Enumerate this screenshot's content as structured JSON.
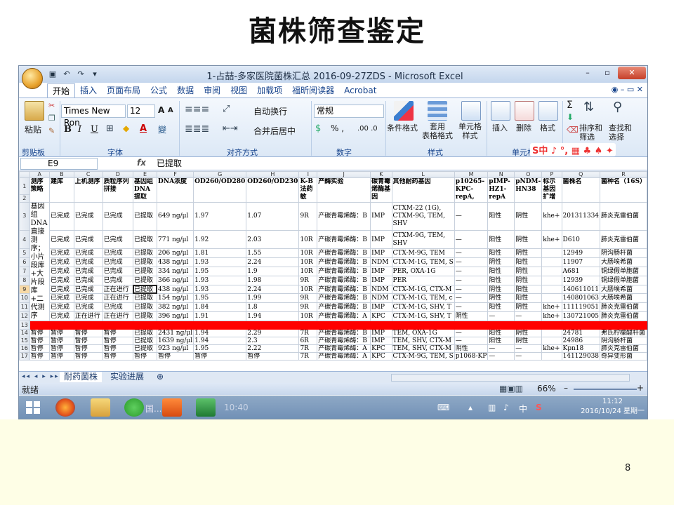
{
  "slide": {
    "title": "菌株筛查鉴定",
    "page_number": "8"
  },
  "window": {
    "title": "1-占喆-多家医院菌株汇总 2016-09-27ZDS - Microsoft Excel",
    "office_button_label": "",
    "controls": {
      "minimize": "–",
      "restore": "▫",
      "close": "✕"
    }
  },
  "tabs": [
    "开始",
    "插入",
    "页面布局",
    "公式",
    "数据",
    "审阅",
    "视图",
    "加载项",
    "福昕阅读器",
    "Acrobat"
  ],
  "tabs_right": "◉ – ▭ ✕",
  "ribbon": {
    "paste": "粘贴",
    "font_name": "Times New Ron",
    "font_size": "12",
    "wrap_text": "自动换行",
    "merge_center": "合并后居中",
    "number_format": "常规",
    "percent_comma": "% ,",
    "decimals": ".00 .0",
    "conditional_format": "条件格式",
    "table_format": "套用\n表格格式",
    "cell_style": "单元格\n样式",
    "insert": "插入",
    "delete": "删除",
    "format": "格式",
    "sort_filter": "排序和\n筛选",
    "find_select": "查找和\n选择",
    "groups": [
      "剪贴板",
      "字体",
      "对齐方式",
      "数字",
      "样式",
      "单元格"
    ],
    "bold": "B",
    "italic": "I",
    "underline": "U",
    "font_grow": "A",
    "font_shrink": "A",
    "font_color": "A",
    "fill_color": "◆",
    "sigma": "Σ",
    "ime_bar": "S中 ♪ °, ▦ ♣ ♠ ✦"
  },
  "formula_bar": {
    "cell_ref": "E9",
    "fx": "fx",
    "content": "已提取"
  },
  "columns": [
    "",
    "A",
    "B",
    "C",
    "D",
    "E",
    "F",
    "G",
    "H",
    "I",
    "J",
    "K",
    "L",
    "M",
    "N",
    "O",
    "P",
    "Q",
    "R"
  ],
  "header_row": {
    "row_label": "1",
    "cells": [
      "测序策略",
      "建库",
      "上机测序",
      "质粒序列拼接",
      "基因组DNA提取",
      "DNA浓度",
      "OD260/OD280",
      "OD260/OD230",
      "K-B法药敏",
      "产酶实验",
      "碳青霉烯酶基因",
      "其他耐药基因",
      "p10265-KPC-repA,",
      "pIMP-HZ1-repA",
      "pNDM-HN38",
      "标示基因扩增",
      "菌株名",
      "菌种名（16S）"
    ]
  },
  "header_row2": "2",
  "merged_strategy": "基因组DNA直接测序；小片段库+大片段库+二代测序",
  "rows": [
    {
      "label": "3",
      "cells": [
        "已完成",
        "已完成",
        "已完成",
        "已提取",
        "649 ng/μl",
        "1.97",
        "1.07",
        "9R",
        "产碳青霉烯酶：B",
        "IMP",
        "CTXM-22 (1G), CTXM-9G, TEM, SHV",
        "—",
        "阳性",
        "阴性",
        "khe+",
        "201311334",
        "肺炎克雷伯菌"
      ]
    },
    {
      "label": "4",
      "cells": [
        "已完成",
        "已完成",
        "已完成",
        "已提取",
        "771 ng/μl",
        "1.92",
        "2.03",
        "10R",
        "产碳青霉烯酶：B",
        "IMP",
        "CTXM-9G, TEM, SHV",
        "—",
        "阳性",
        "阴性",
        "khe+",
        "D610",
        "肺炎克雷伯菌"
      ]
    },
    {
      "label": "5",
      "cells": [
        "已完成",
        "已完成",
        "已完成",
        "已提取",
        "206 ng/μl",
        "1.81",
        "1.55",
        "10R",
        "产碳青霉烯酶：B",
        "IMP",
        "CTX-M-9G, TEM",
        "—",
        "阳性",
        "阴性",
        "",
        "12949",
        "阴沟肠杆菌"
      ]
    },
    {
      "label": "6",
      "cells": [
        "已完成",
        "已完成",
        "已完成",
        "已提取",
        "438 ng/μl",
        "1.93",
        "2.24",
        "10R",
        "产碳青霉烯酶：B",
        "NDM",
        "CTX-M-1G, TEM, S",
        "—",
        "阴性",
        "阳性",
        "",
        "11907",
        "大肠埃希菌"
      ]
    },
    {
      "label": "7",
      "cells": [
        "已完成",
        "已完成",
        "已完成",
        "已提取",
        "334 ng/μl",
        "1.95",
        "1.9",
        "10R",
        "产碳青霉烯酶：B",
        "IMP",
        "PER, OXA-1G",
        "—",
        "阳性",
        "阴性",
        "",
        "A681",
        "铜绿假单胞菌"
      ]
    },
    {
      "label": "8",
      "cells": [
        "已完成",
        "已完成",
        "已完成",
        "已提取",
        "366 ng/μl",
        "1.93",
        "1.98",
        "9R",
        "产碳青霉烯酶：B",
        "IMP",
        "PER",
        "—",
        "阳性",
        "阴性",
        "",
        "12939",
        "铜绿假单胞菌"
      ]
    },
    {
      "label": "9",
      "cells": [
        "已完成",
        "已完成",
        "正在进行",
        "已提取",
        "438 ng/μl",
        "1.93",
        "2.24",
        "10R",
        "产碳青霉烯酶：B",
        "NDM",
        "CTX-M-1G, CTX-M",
        "—",
        "阴性",
        "阳性",
        "",
        "140611011",
        "大肠埃希菌"
      ]
    },
    {
      "label": "10",
      "cells": [
        "已完成",
        "已完成",
        "正在进行",
        "已提取",
        "154 ng/μl",
        "1.95",
        "1.99",
        "9R",
        "产碳青霉烯酶：B",
        "NDM",
        "CTX-M-1G, TEM, c",
        "—",
        "阴性",
        "阳性",
        "",
        "140801063",
        "大肠埃希菌"
      ]
    },
    {
      "label": "11",
      "cells": [
        "已完成",
        "已完成",
        "已完成",
        "已提取",
        "382 ng/μl",
        "1.84",
        "1.8",
        "9R",
        "产碳青霉烯酶：B",
        "IMP",
        "CTX-M-1G, SHV, T",
        "—",
        "阳性",
        "阴性",
        "khe+",
        "111119051",
        "肺炎克雷伯菌"
      ]
    },
    {
      "label": "12",
      "cells": [
        "已完成",
        "正在进行",
        "正在进行",
        "已提取",
        "396 ng/μl",
        "1.91",
        "1.94",
        "10R",
        "产碳青霉烯酶：A",
        "KPC",
        "CTX-M-1G, SHV, T",
        "阴性",
        "—",
        "—",
        "khe+",
        "130721005",
        "肺炎克雷伯菌"
      ]
    }
  ],
  "red_row_label": "13",
  "bottom_rows": [
    {
      "label": "14",
      "cells": [
        "暂停",
        "暂停",
        "暂停",
        "暂停",
        "已提取",
        "2431 ng/μl",
        "1.94",
        "2.29",
        "7R",
        "产碳青霉烯酶：B",
        "IMP",
        "TEM, OXA-1G",
        "—",
        "阳性",
        "阴性",
        "",
        "24781",
        "弗氏柠檬酸杆菌"
      ]
    },
    {
      "label": "15",
      "cells": [
        "暂停",
        "暂停",
        "暂停",
        "暂停",
        "已提取",
        "1639 ng/μl",
        "1.94",
        "2.3",
        "6R",
        "产碳青霉烯酶：B",
        "IMP",
        "TEM, SHV, CTX-M",
        "—",
        "阳性",
        "阴性",
        "",
        "24986",
        "阴沟肠杆菌"
      ]
    },
    {
      "label": "16",
      "cells": [
        "暂停",
        "暂停",
        "暂停",
        "暂停",
        "已提取",
        "923 ng/μl",
        "1.95",
        "2.22",
        "7R",
        "产碳青霉烯酶：A",
        "KPC",
        "TEM, SHV, CTX-M",
        "阴性",
        "—",
        "—",
        "khe+",
        "Kpn18",
        "肺炎克雷伯菌"
      ]
    },
    {
      "label": "17",
      "cells": [
        "暂停",
        "暂停",
        "暂停",
        "暂停",
        "暂停",
        "暂停",
        "暂停",
        "暂停",
        "7R",
        "产碳青霉烯酶：A",
        "KPC",
        "CTX-M-9G, TEM, S",
        "p1068-KP",
        "—",
        "—",
        "",
        "141129038",
        "奇异变形菌"
      ]
    }
  ],
  "sheet_tabs": [
    "耐药菌株",
    "实验进展"
  ],
  "sheet_nav": "◂◂ ◂ ▸ ▸▸",
  "status": {
    "ready": "就绪",
    "zoom": "66%",
    "zoom_minus": "–",
    "zoom_plus": "+"
  },
  "taskbar": {
    "time": "11:12",
    "date": "2016/10/24 星期一",
    "tray_text": "中",
    "ghost_text": "10:40",
    "ghost_text2": "国..."
  }
}
